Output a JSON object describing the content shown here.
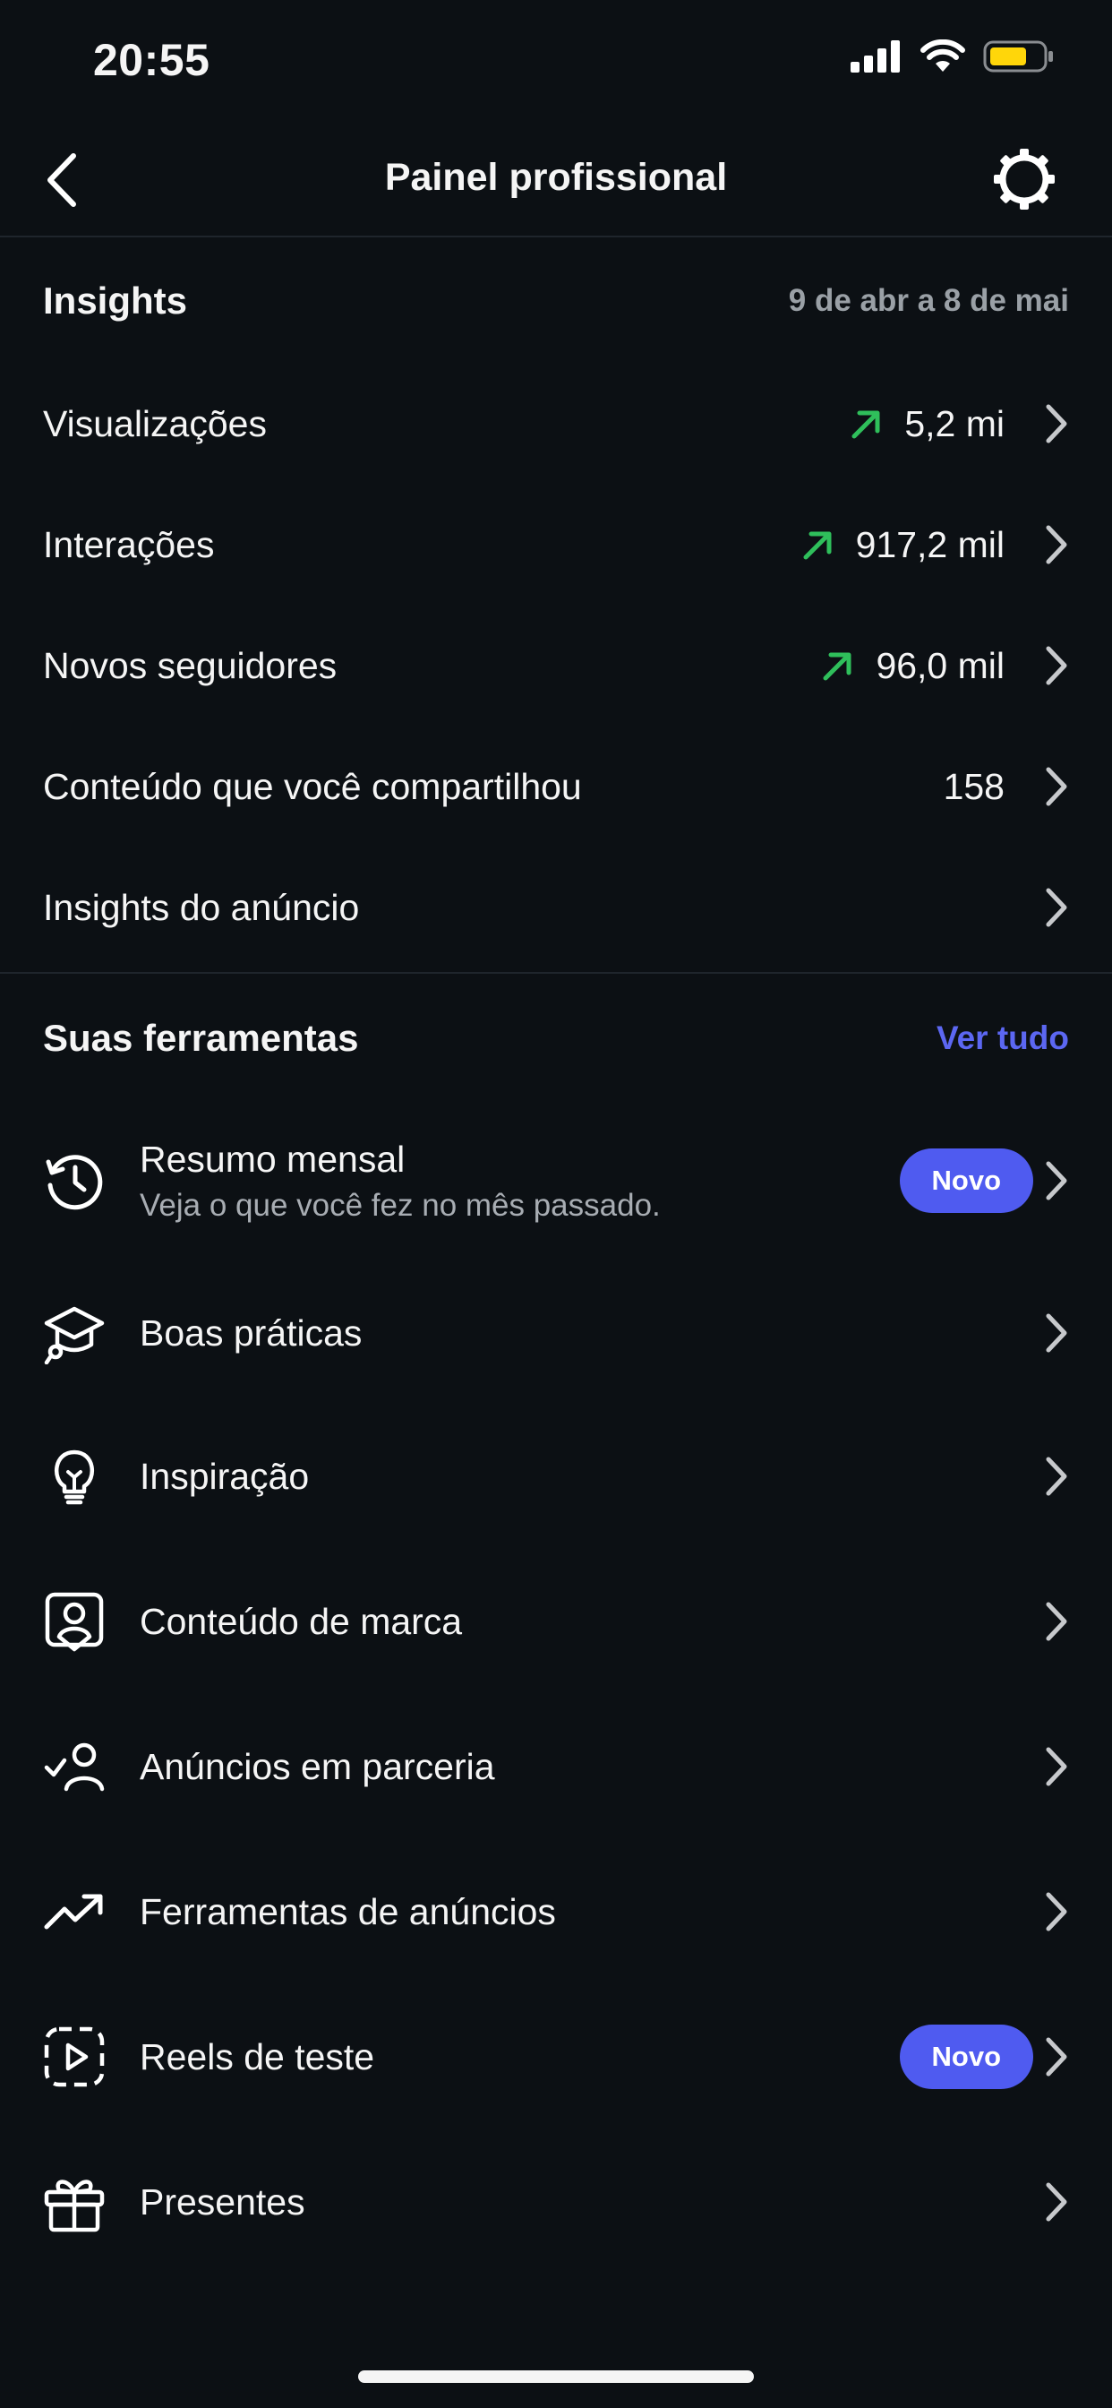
{
  "status_bar": {
    "time": "20:55"
  },
  "header": {
    "title": "Painel profissional"
  },
  "insights": {
    "title": "Insights",
    "date_range": "9 de abr a 8 de mai",
    "rows": [
      {
        "label": "Visualizações",
        "value": "5,2 mi",
        "trend": "up"
      },
      {
        "label": "Interações",
        "value": "917,2 mil",
        "trend": "up"
      },
      {
        "label": "Novos seguidores",
        "value": "96,0 mil",
        "trend": "up"
      },
      {
        "label": "Conteúdo que você compartilhou",
        "value": "158"
      },
      {
        "label": "Insights do anúncio"
      }
    ]
  },
  "tools": {
    "title": "Suas ferramentas",
    "see_all": "Ver tudo",
    "badge_label": "Novo",
    "items": [
      {
        "label": "Resumo mensal",
        "sublabel": "Veja o que você fez no mês passado.",
        "badge": "Novo",
        "icon": "history-icon"
      },
      {
        "label": "Boas práticas",
        "icon": "graduation-cap-icon"
      },
      {
        "label": "Inspiração",
        "icon": "lightbulb-icon"
      },
      {
        "label": "Conteúdo de marca",
        "icon": "branded-content-icon"
      },
      {
        "label": "Anúncios em parceria",
        "icon": "partner-check-icon"
      },
      {
        "label": "Ferramentas de anúncios",
        "icon": "trending-up-icon"
      },
      {
        "label": "Reels de teste",
        "badge": "Novo",
        "icon": "reels-test-icon"
      },
      {
        "label": "Presentes",
        "icon": "gift-icon"
      }
    ]
  },
  "colors": {
    "background": "#0c1014",
    "accent": "#5c67f2",
    "badge": "#4f5bf0",
    "trend_up": "#2fbf5b",
    "battery": "#ffd60a"
  }
}
